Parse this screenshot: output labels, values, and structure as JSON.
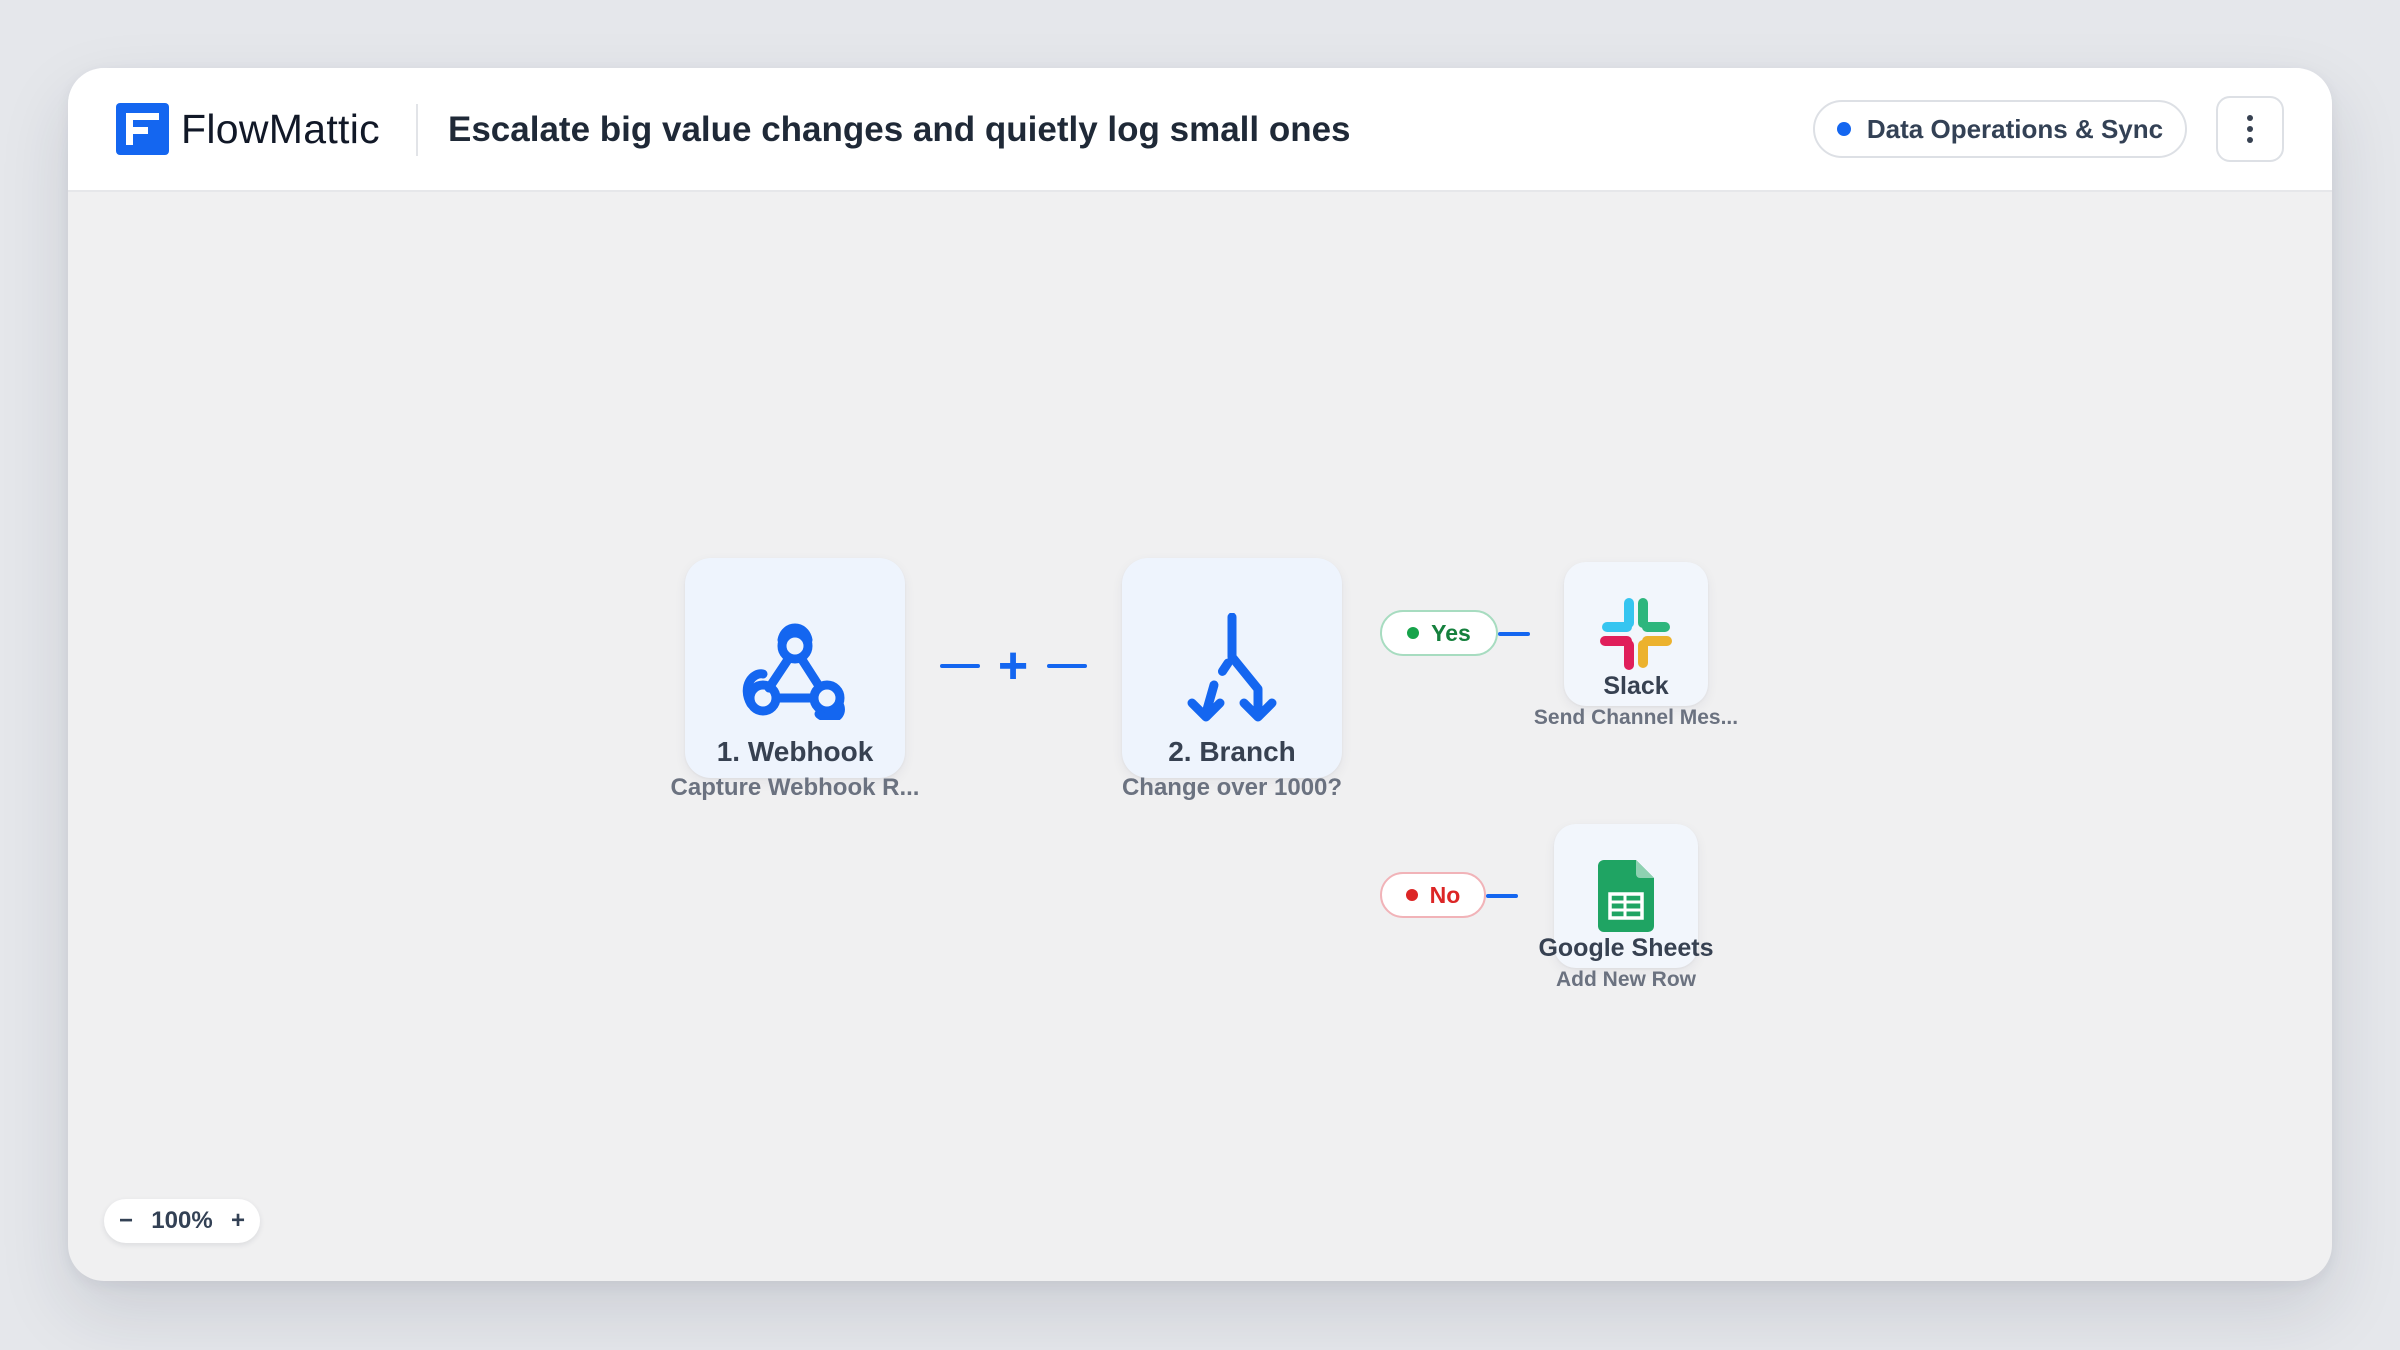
{
  "app": {
    "brand": "FlowMattic"
  },
  "workflow": {
    "title": "Escalate big value changes and quietly log small ones"
  },
  "category": {
    "label": "Data Operations & Sync",
    "dot_color": "#1466f0"
  },
  "nodes": [
    {
      "title": "1. Webhook",
      "subtitle": "Capture Webhook R...",
      "icon": "webhook-icon"
    },
    {
      "title": "2. Branch",
      "subtitle": "Change over 1000?",
      "icon": "branch-icon"
    }
  ],
  "branches": [
    {
      "label": "Yes",
      "app": "Slack",
      "action": "Send Channel Mes...",
      "icon": "slack-icon",
      "color": "#16a34a"
    },
    {
      "label": "No",
      "app": "Google Sheets",
      "action": "Add New Row",
      "icon": "google-sheets-icon",
      "color": "#dc2626"
    }
  ],
  "zoom": {
    "minus": "−",
    "level": "100%",
    "plus": "+"
  },
  "accent": "#1466f0"
}
